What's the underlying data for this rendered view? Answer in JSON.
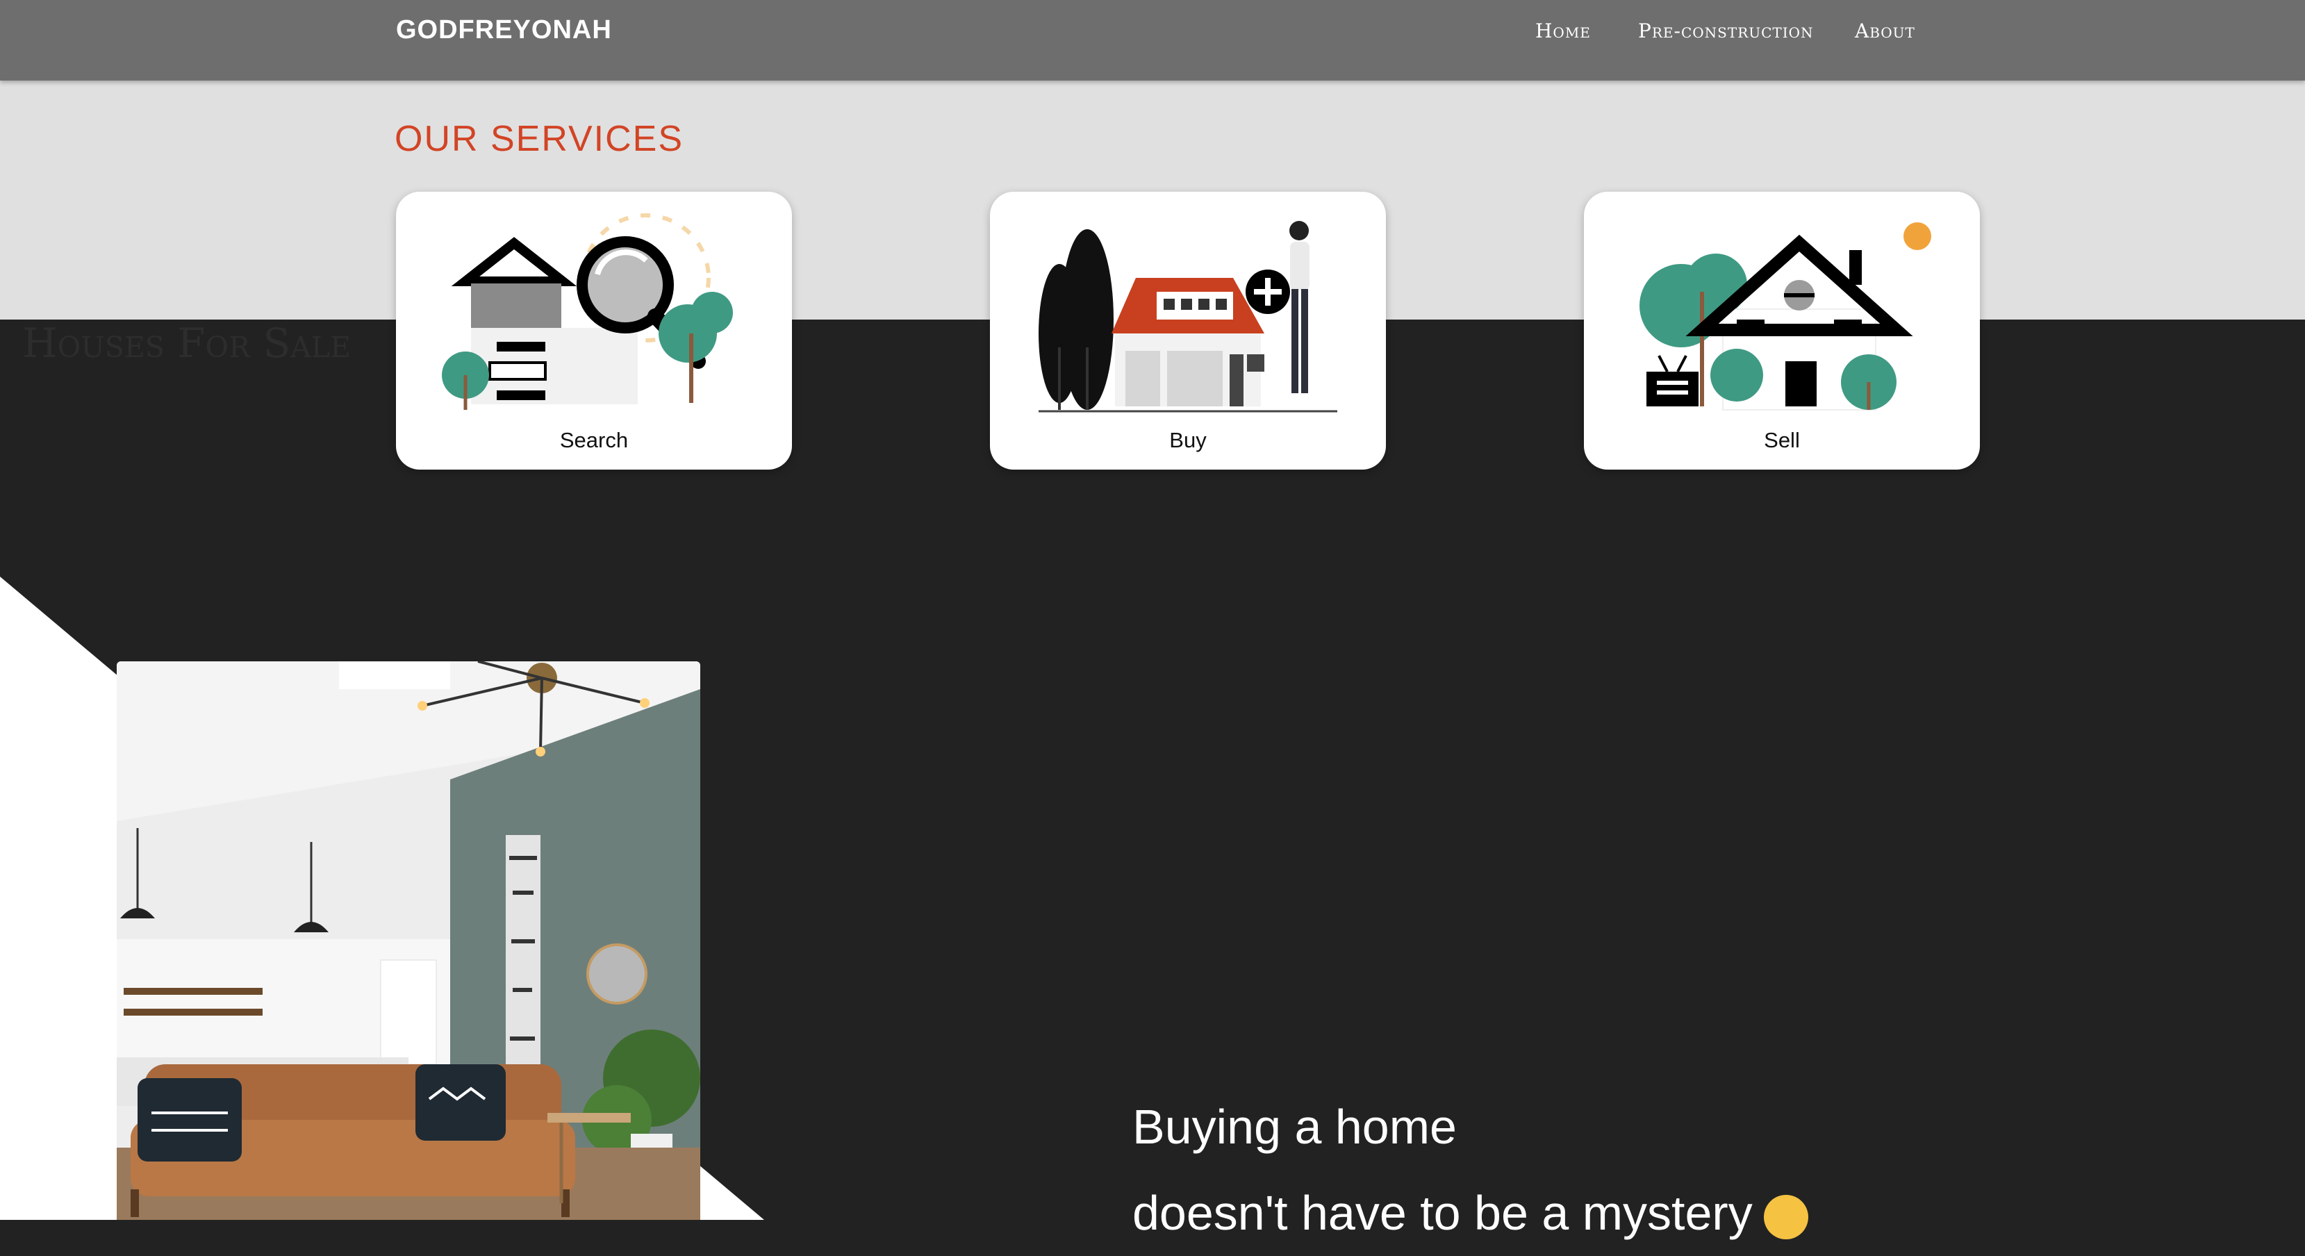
{
  "navbar": {
    "brand": "GODFREYONAH",
    "links": [
      "Home",
      "Pre-construction",
      "About"
    ]
  },
  "services": {
    "title": "OUR SERVICES",
    "cards": [
      {
        "label": "Search"
      },
      {
        "label": "Buy"
      },
      {
        "label": "Sell"
      }
    ]
  },
  "houses": {
    "heading": "Houses For Sale"
  },
  "hero": {
    "line1": "Buying a home",
    "line2": "doesn't have to be a mystery",
    "emoji_icon": "thinking-face-emoji"
  },
  "colors": {
    "navbar": "#6e6e6e",
    "accent": "#d24425",
    "dark_bg": "#222222",
    "light_band": "#e0e0e0",
    "illustration_green": "#3f9a83",
    "illustration_red": "#c8401f"
  }
}
